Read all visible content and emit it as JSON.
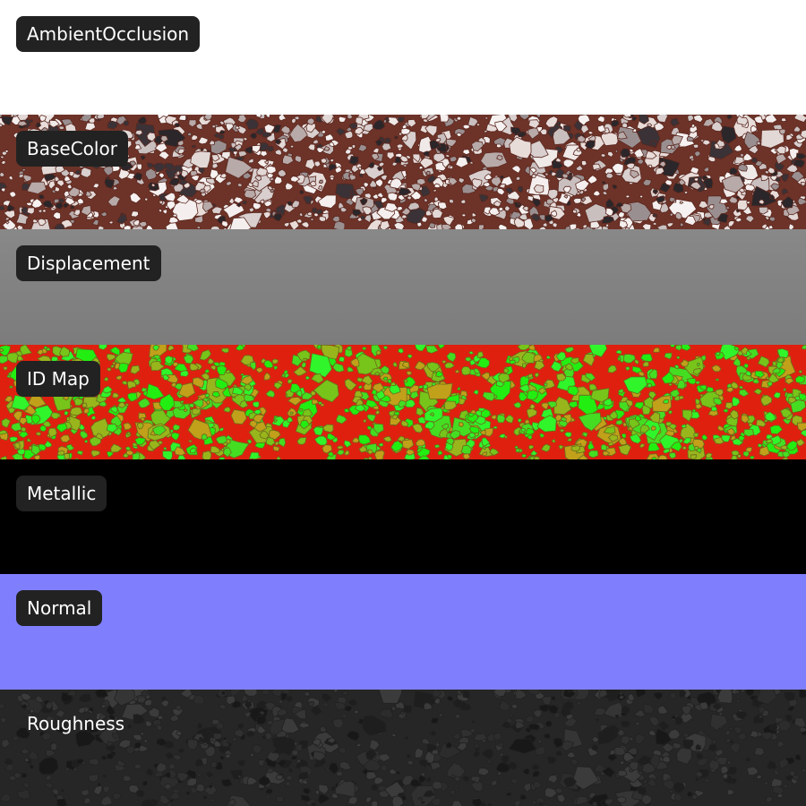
{
  "maps": [
    {
      "id": "ambient-occlusion",
      "label": "AmbientOcclusion",
      "base": "#ffffff",
      "texture": "flat"
    },
    {
      "id": "base-color",
      "label": "BaseColor",
      "base": "#6e3328",
      "texture": "terrazzo-color"
    },
    {
      "id": "displacement",
      "label": "Displacement",
      "base": "#808080",
      "texture": "flat-gradient"
    },
    {
      "id": "id-map",
      "label": "ID Map",
      "base": "#e0200f",
      "texture": "terrazzo-id"
    },
    {
      "id": "metallic",
      "label": "Metallic",
      "base": "#000000",
      "texture": "flat"
    },
    {
      "id": "normal",
      "label": "Normal",
      "base": "#7f7ffd",
      "texture": "flat"
    },
    {
      "id": "roughness",
      "label": "Roughness",
      "base": "#262626",
      "texture": "terrazzo-dark"
    }
  ]
}
